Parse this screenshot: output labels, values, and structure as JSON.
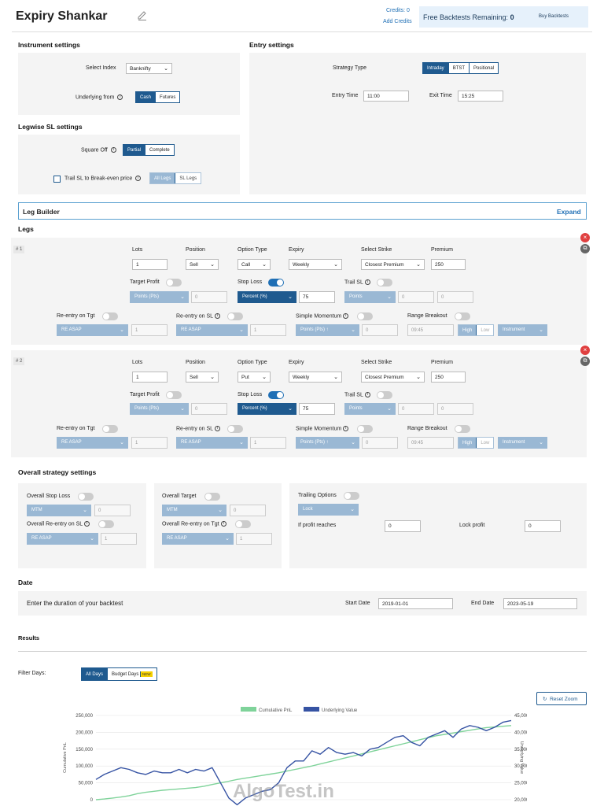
{
  "header": {
    "title": "Expiry Shankar",
    "credits_label": "Credits: 0",
    "add_credits": "Add Credits",
    "free_backtests_label": "Free Backtests Remaining:",
    "free_backtests_value": "0",
    "buy_backtests": "Buy Backtests"
  },
  "instrument": {
    "title": "Instrument settings",
    "select_index_label": "Select Index",
    "select_index_value": "Banknifty",
    "underlying_label": "Underlying from",
    "underlying_options": [
      "Cash",
      "Futures"
    ]
  },
  "legwise": {
    "title": "Legwise SL settings",
    "square_off_label": "Square Off",
    "square_off_options": [
      "Partial",
      "Complete"
    ],
    "trail_label": "Trail SL to Break-even price",
    "trail_options": [
      "All Legs",
      "SL Legs"
    ]
  },
  "entry": {
    "title": "Entry settings",
    "strategy_type_label": "Strategy Type",
    "strategy_options": [
      "Intraday",
      "BTST",
      "Positional"
    ],
    "entry_time_label": "Entry Time",
    "entry_time_value": "11:00",
    "exit_time_label": "Exit Time",
    "exit_time_value": "15:25"
  },
  "leg_builder": {
    "title": "Leg Builder",
    "expand": "Expand"
  },
  "legs_title": "Legs",
  "leg_labels": {
    "lots": "Lots",
    "position": "Position",
    "option_type": "Option Type",
    "expiry": "Expiry",
    "select_strike": "Select Strike",
    "premium": "Premium",
    "target_profit": "Target Profit",
    "stop_loss": "Stop Loss",
    "trail_sl": "Trail SL",
    "reentry_tgt": "Re-entry on Tgt",
    "reentry_sl": "Re-entry on SL",
    "simple_momentum": "Simple Momentum",
    "range_breakout": "Range Breakout",
    "tp_mode": "Points (Pts)",
    "sl_mode": "Percent (%)",
    "trail_mode": "Points",
    "re_asap": "RE ASAP",
    "momentum_mode": "Points (Pts) ↑",
    "range_time": "09:45",
    "high": "High",
    "low": "Low",
    "instrument": "Instrument",
    "zero": "0"
  },
  "legs": [
    {
      "num": "# 1",
      "lots": "1",
      "position": "Sell",
      "option_type": "Call",
      "expiry": "Weekly",
      "strike": "Closest Premium",
      "premium": "250",
      "sl_value": "75",
      "reentry_count": "1"
    },
    {
      "num": "# 2",
      "lots": "1",
      "position": "Sell",
      "option_type": "Put",
      "expiry": "Weekly",
      "strike": "Closest Premium",
      "premium": "250",
      "sl_value": "75",
      "reentry_count": "1"
    }
  ],
  "overall": {
    "title": "Overall strategy settings",
    "stop_loss_label": "Overall Stop Loss",
    "target_label": "Overall Target",
    "reentry_sl_label": "Overall Re-entry on SL",
    "reentry_tgt_label": "Overall Re-entry on Tgt",
    "mtm": "MTM",
    "re_asap": "RE ASAP",
    "zero": "0",
    "one": "1",
    "trailing_label": "Trailing Options",
    "lock": "Lock",
    "if_profit_label": "If profit reaches",
    "if_profit_value": "0",
    "lock_profit_label": "Lock profit",
    "lock_profit_value": "0"
  },
  "date": {
    "title": "Date",
    "prompt": "Enter the duration of your backtest",
    "start_label": "Start Date",
    "start_value": "2019-01-01",
    "end_label": "End Date",
    "end_value": "2023-05-19"
  },
  "results": {
    "title": "Results",
    "filter_label": "Filter Days:",
    "filter_options": [
      "All Days",
      "Budget Days"
    ],
    "new_badge": "NEW",
    "reset_zoom": "Reset Zoom",
    "watermark": "AlgoTest.in"
  },
  "colors": {
    "accent": "#1f5a8f",
    "light_accent": "#9ab8d4",
    "pnl": "#7fd39a",
    "underlying": "#3653a3",
    "danger": "#e04040"
  },
  "chart_data": {
    "type": "line",
    "legend": [
      "Cumulative PnL",
      "Underlying Value"
    ],
    "legend_position": "top",
    "ylabel_left": "Cumulative PnL",
    "ylabel_right": "Underlying Value",
    "yticks_left": [
      "250,000",
      "200,000",
      "150,000",
      "100,000",
      "50,000",
      "0"
    ],
    "yticks_right": [
      "45,000",
      "40,000",
      "35,000",
      "30,000",
      "25,000",
      "20,000"
    ],
    "ylim_left": [
      0,
      250000
    ],
    "ylim_right": [
      20000,
      45000
    ],
    "series": [
      {
        "name": "Cumulative PnL",
        "axis": "left",
        "values": [
          0,
          2000,
          5000,
          8000,
          12000,
          18000,
          22000,
          25000,
          28000,
          30000,
          32000,
          34000,
          36000,
          40000,
          45000,
          50000,
          55000,
          60000,
          64000,
          68000,
          72000,
          76000,
          80000,
          85000,
          90000,
          95000,
          100000,
          106000,
          112000,
          118000,
          124000,
          130000,
          136000,
          142000,
          148000,
          154000,
          160000,
          166000,
          172000,
          178000,
          184000,
          190000,
          194000,
          198000,
          202000,
          206000,
          210000,
          214000,
          216000,
          218000,
          220000
        ]
      },
      {
        "name": "Underlying Value",
        "axis": "right",
        "values": [
          26000,
          27500,
          28500,
          29500,
          29000,
          28000,
          27500,
          28500,
          28000,
          28000,
          29000,
          28000,
          29000,
          28500,
          29500,
          25000,
          20500,
          18500,
          20500,
          21500,
          22500,
          23000,
          25000,
          29500,
          31500,
          31500,
          34500,
          33500,
          35500,
          34000,
          33500,
          34000,
          33000,
          35000,
          35500,
          37000,
          38500,
          39000,
          37000,
          36000,
          38500,
          39500,
          40500,
          38500,
          41000,
          42000,
          41500,
          40500,
          41500,
          43000,
          43500
        ]
      }
    ]
  }
}
